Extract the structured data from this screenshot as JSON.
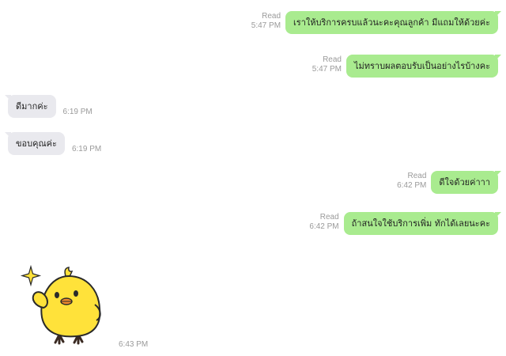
{
  "messages": [
    {
      "direction": "out",
      "text": "เราให้บริการครบแล้วนะคะคุณลูกค้า มีแถมให้ด้วยค่ะ",
      "status": "Read",
      "time": "5:47 PM"
    },
    {
      "direction": "out",
      "text": "ไม่ทราบผลตอบรับเป็นอย่างไรบ้างคะ",
      "status": "Read",
      "time": "5:47 PM"
    },
    {
      "direction": "in",
      "text": "ดีมากค่ะ",
      "time": "6:19 PM"
    },
    {
      "direction": "in",
      "text": "ขอบคุณค่ะ",
      "time": "6:19 PM"
    },
    {
      "direction": "out",
      "text": "ดีใจด้วยค่าาา",
      "status": "Read",
      "time": "6:42 PM"
    },
    {
      "direction": "out",
      "text": "ถ้าสนใจใช้บริการเพิ่ม ทักได้เลยนะคะ",
      "status": "Read",
      "time": "6:42 PM"
    }
  ],
  "sticker": {
    "icon": "yellow-chick-sticker",
    "time": "6:43 PM"
  },
  "colors": {
    "outgoing_bubble": "#a9eb8f",
    "incoming_bubble": "#e9e9ee",
    "meta_text": "#9a9a9a"
  }
}
